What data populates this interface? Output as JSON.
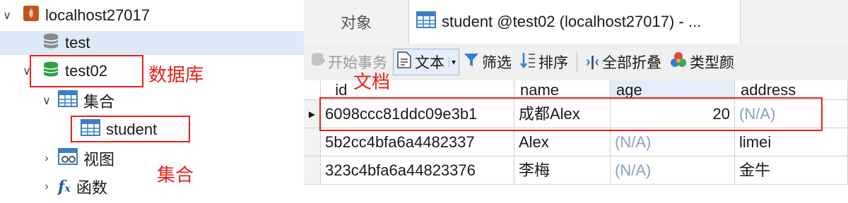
{
  "tree": {
    "connection": "localhost27017",
    "db_test": "test",
    "db_test02": "test02",
    "folder_collections": "集合",
    "collection_student": "student",
    "folder_views": "视图",
    "folder_functions": "函数"
  },
  "annotations": {
    "database": "数据库",
    "collection": "集合",
    "document": "文档"
  },
  "tabs": {
    "objects": "对象",
    "student": "student @test02 (localhost27017) - ..."
  },
  "toolbar": {
    "begin_transaction": "开始事务",
    "text": "文本",
    "filter": "筛选",
    "sort": "排序",
    "collapse_all": "全部折叠",
    "type_color": "类型颜"
  },
  "grid": {
    "columns": [
      "_id",
      "name",
      "age",
      "address"
    ],
    "rows": [
      [
        "6098ccc81ddc09e3b1",
        "成都Alex",
        "20",
        "(N/A)"
      ],
      [
        "5b2cc4bfa6a4482337",
        "Alex",
        "(N/A)",
        "limei"
      ],
      [
        "323c4bfa6a44823376",
        "李梅",
        "(N/A)",
        "金牛"
      ]
    ]
  },
  "colors": {
    "selection": "#dce9f7",
    "annotation_red": "#e8201a",
    "db_green": "#2ea043",
    "null_text": "#8a9fbf"
  }
}
